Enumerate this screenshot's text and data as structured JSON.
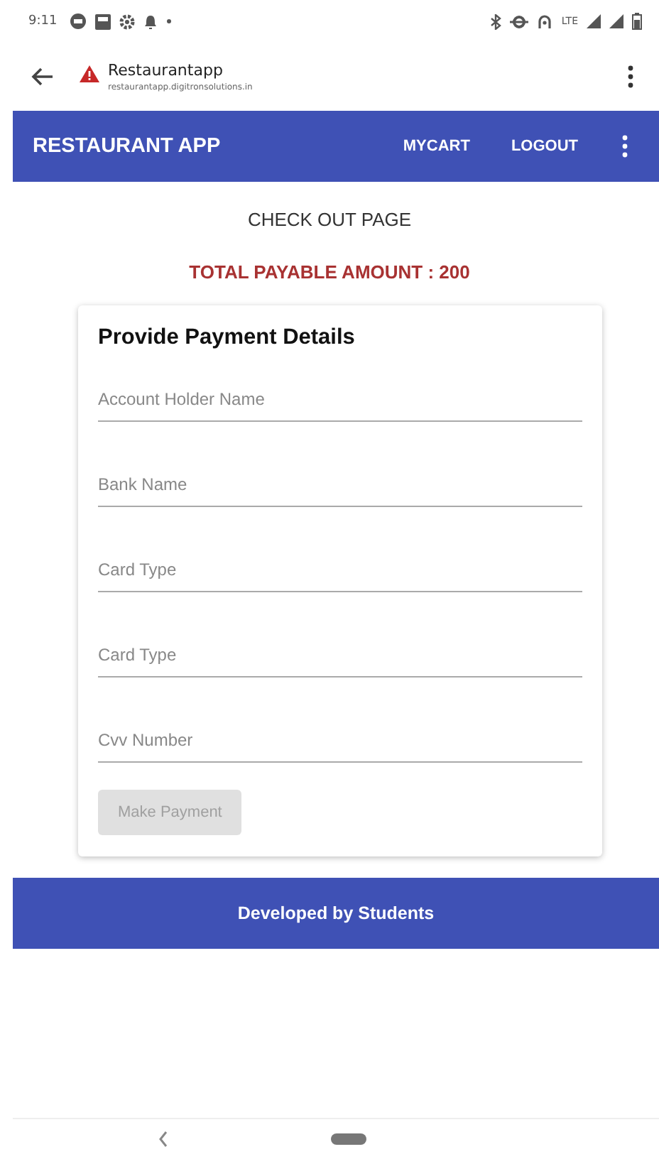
{
  "status_bar": {
    "time": "9:11",
    "network": "LTE"
  },
  "browser": {
    "title": "Restaurantapp",
    "url": "restaurantapp.digitronsolutions.in"
  },
  "app_bar": {
    "title": "RESTAURANT APP",
    "actions": [
      "MYCART",
      "LOGOUT"
    ]
  },
  "page_title": "CHECK OUT PAGE",
  "total": "TOTAL PAYABLE AMOUNT : 200",
  "form": {
    "title": "Provide Payment Details",
    "fields": [
      {
        "placeholder": "Account Holder Name"
      },
      {
        "placeholder": "Bank Name"
      },
      {
        "placeholder": "Card Type"
      },
      {
        "placeholder": "Card Type"
      },
      {
        "placeholder": "Cvv Number"
      }
    ],
    "button": {
      "label": "Make Payment",
      "disabled": true
    }
  },
  "footer": "Developed by Students"
}
